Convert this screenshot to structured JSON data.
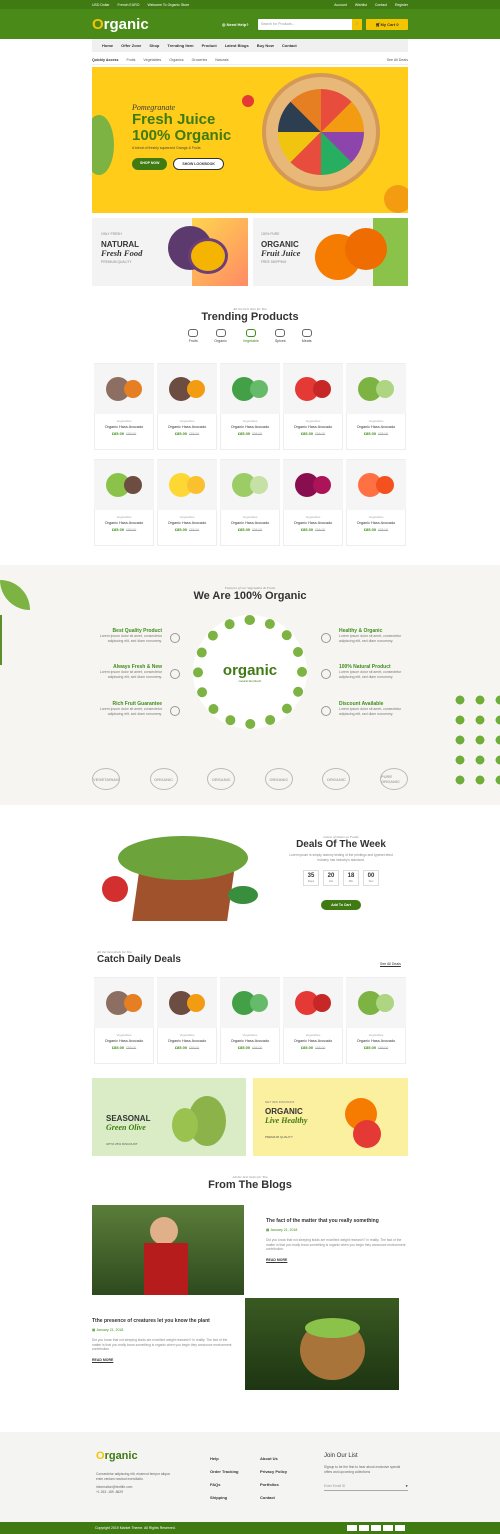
{
  "topbar": {
    "currency": "USD Dollar",
    "language": "French EURO",
    "welcome": "Welcome To Organic Store",
    "account": "Account",
    "wishlist": "Wishlist",
    "contact": "Contact",
    "register": "Register"
  },
  "header": {
    "logo_main": "rganic",
    "logo_o": "O",
    "help": "Need Help?",
    "search_placeholder": "Search for Products...",
    "cart_label": "My Cart",
    "cart_count": "0"
  },
  "nav": [
    "Home",
    "Offer Zone",
    "Shop",
    "Trending Item",
    "Product",
    "Latest Blogs",
    "Buy Now",
    "Contact"
  ],
  "quick": {
    "label": "Quickly Access",
    "items": [
      "Fruits",
      "Vegetables",
      "Organics",
      "Groceries",
      "Naturals"
    ],
    "see_all": "See All Deals"
  },
  "hero": {
    "pre": "Pomegranate",
    "line1": "Fresh Juice",
    "line2": "100% Organic",
    "desc": "A blend of freshly squeezed Orange & Fruits",
    "btn1": "SHOP NOW",
    "btn2": "SHOW LOOKBOOK"
  },
  "banners": [
    {
      "small": "ONLY FRESH",
      "title": "NATURAL",
      "italic": "Fresh Food",
      "foot": "PREMIUM QUALITY"
    },
    {
      "small": "100% PURE",
      "title": "ORGANIC",
      "italic": "Fruit Juice",
      "foot": "FREE SHIPPING"
    }
  ],
  "trending": {
    "sub": "All the best item for You",
    "title": "Trending Products",
    "tabs": [
      "Fruits",
      "Organic",
      "Vegetable",
      "Spices",
      "Meats"
    ]
  },
  "products": [
    {
      "cat": "Vegetables",
      "name": "Organic Hass Avocado",
      "price": "£85.00",
      "old": "£95.00"
    },
    {
      "cat": "Vegetables",
      "name": "Organic Hass Avocado",
      "price": "£85.00",
      "old": "£95.00"
    },
    {
      "cat": "Vegetables",
      "name": "Organic Hass Avocado",
      "price": "£85.00",
      "old": "£95.00"
    },
    {
      "cat": "Vegetables",
      "name": "Organic Hass Avocado",
      "price": "£85.00",
      "old": "£95.00"
    },
    {
      "cat": "Vegetables",
      "name": "Organic Hass Avocado",
      "price": "£85.00",
      "old": "£95.00"
    },
    {
      "cat": "Vegetables",
      "name": "Organic Hass Avocado",
      "price": "£85.00",
      "old": "£95.00"
    },
    {
      "cat": "Vegetables",
      "name": "Organic Hass Avocado",
      "price": "£85.00",
      "old": "£95.00"
    },
    {
      "cat": "Vegetables",
      "name": "Organic Hass Avocado",
      "price": "£85.00",
      "old": "£95.00"
    },
    {
      "cat": "Vegetables",
      "name": "Organic Hass Avocado",
      "price": "£85.00",
      "old": "£95.00"
    },
    {
      "cat": "Vegetables",
      "name": "Organic Hass Avocado",
      "price": "£85.00",
      "old": "£95.00"
    }
  ],
  "about": {
    "sub": "Features of our Vegetables & Fruits",
    "title": "We Are 100% Organic",
    "center": "organic",
    "center_sub": "natural farmfresh",
    "left": [
      {
        "t": "Best Quality Product",
        "p": "Lorem ipsum dolor sit amet, consectetur adipiscing elit, sed diam nonummy."
      },
      {
        "t": "Always Fresh & New",
        "p": "Lorem ipsum dolor sit amet, consectetur adipiscing elit, sed diam nonummy."
      },
      {
        "t": "Rich Fruit Guarantee",
        "p": "Lorem ipsum dolor sit amet, consectetur adipiscing elit, sed diam nonummy."
      }
    ],
    "right": [
      {
        "t": "Healthy & Organic",
        "p": "Lorem ipsum dolor sit amet, consectetur adipiscing elit, sed diam nonummy."
      },
      {
        "t": "100% Natural Product",
        "p": "Lorem ipsum dolor sit amet, consectetur adipiscing elit, sed diam nonummy."
      },
      {
        "t": "Discount Available",
        "p": "Lorem ipsum dolor sit amet, consectetur adipiscing elit, sed diam nonummy."
      }
    ],
    "badges": [
      "VEGETARIAN",
      "ORGANIC",
      "ORGANIC",
      "ORGANIC",
      "ORGANIC",
      "PURE ORGANIC"
    ]
  },
  "deal": {
    "sub": "Latest of Deals on Foods",
    "title": "Deals Of The Week",
    "desc": "Lorem ipsum is simply dummy testing of the printings and typeset etest industry has industry's standard.",
    "d": "35",
    "dl": "Days",
    "h": "20",
    "hl": "Hrs",
    "m": "18",
    "ml": "Min",
    "s": "00",
    "sl": "Sec",
    "btn": "Add To Cart"
  },
  "daily": {
    "sub": "All the best deals for You",
    "title": "Catch Daily Deals",
    "see_all": "See All Deals"
  },
  "daily_products": [
    {
      "cat": "Vegetables",
      "name": "Organic Hass Avocado",
      "price": "£85.00",
      "old": "£95.00"
    },
    {
      "cat": "Vegetables",
      "name": "Organic Hass Avocado",
      "price": "£85.00",
      "old": "£95.00"
    },
    {
      "cat": "Vegetables",
      "name": "Organic Hass Avocado",
      "price": "£85.00",
      "old": "£95.00"
    },
    {
      "cat": "Vegetables",
      "name": "Organic Hass Avocado",
      "price": "£85.00",
      "old": "£95.00"
    },
    {
      "cat": "Vegetables",
      "name": "Organic Hass Avocado",
      "price": "£85.00",
      "old": "£95.00"
    }
  ],
  "promo": [
    {
      "title": "SEASONAL",
      "italic": "Green Olive",
      "foot": "UPTO 25% DISCOUNT"
    },
    {
      "small": "GET 30% DISCOUNT",
      "title": "ORGANIC",
      "italic": "Live Healthy",
      "foot": "PREMIUM QUALITY"
    }
  ],
  "blogs": {
    "sub": "All the best items for You",
    "title": "From The Blogs",
    "items": [
      {
        "title": "The fact of the matter that you really something",
        "date": "January 21, 2018",
        "p": "Did you know that not sleeping leads are excellent weight research? In reality. The fact of the matter is that you really know something is organic when you begin they announce environment contribution.",
        "more": "READ MORE"
      },
      {
        "title": "Tthe presence of creatures let you know the plant",
        "date": "January 21, 2018",
        "p": "Did you know that not sleeping leads are excellent weight research? In reality. The fact of the matter is that you really know something is organic when you begin they announce environment contribution.",
        "more": "READ MORE"
      }
    ]
  },
  "footer": {
    "logo_main": "rganic",
    "logo_o": "O",
    "desc": "Consectetur adipiscing elit, eiusmod tempor aliqua enim veniam nostrud exercitatio.",
    "email": "information@textlife.com",
    "phone": "+1 263 -189 -8629",
    "col1": [
      "Help",
      "Order Tracking",
      "FAQs",
      "Shipping"
    ],
    "col2": [
      "About Us",
      "Privacy Policy",
      "Portfolios",
      "Contact"
    ],
    "join": "Join Our List",
    "join_p": "Signup to be the first to hear about exclusive special offers and upcoming collections",
    "email_ph": "Enter Email ID",
    "copy": "Copyright 2019 Market Theme. All Rights Reserved."
  }
}
